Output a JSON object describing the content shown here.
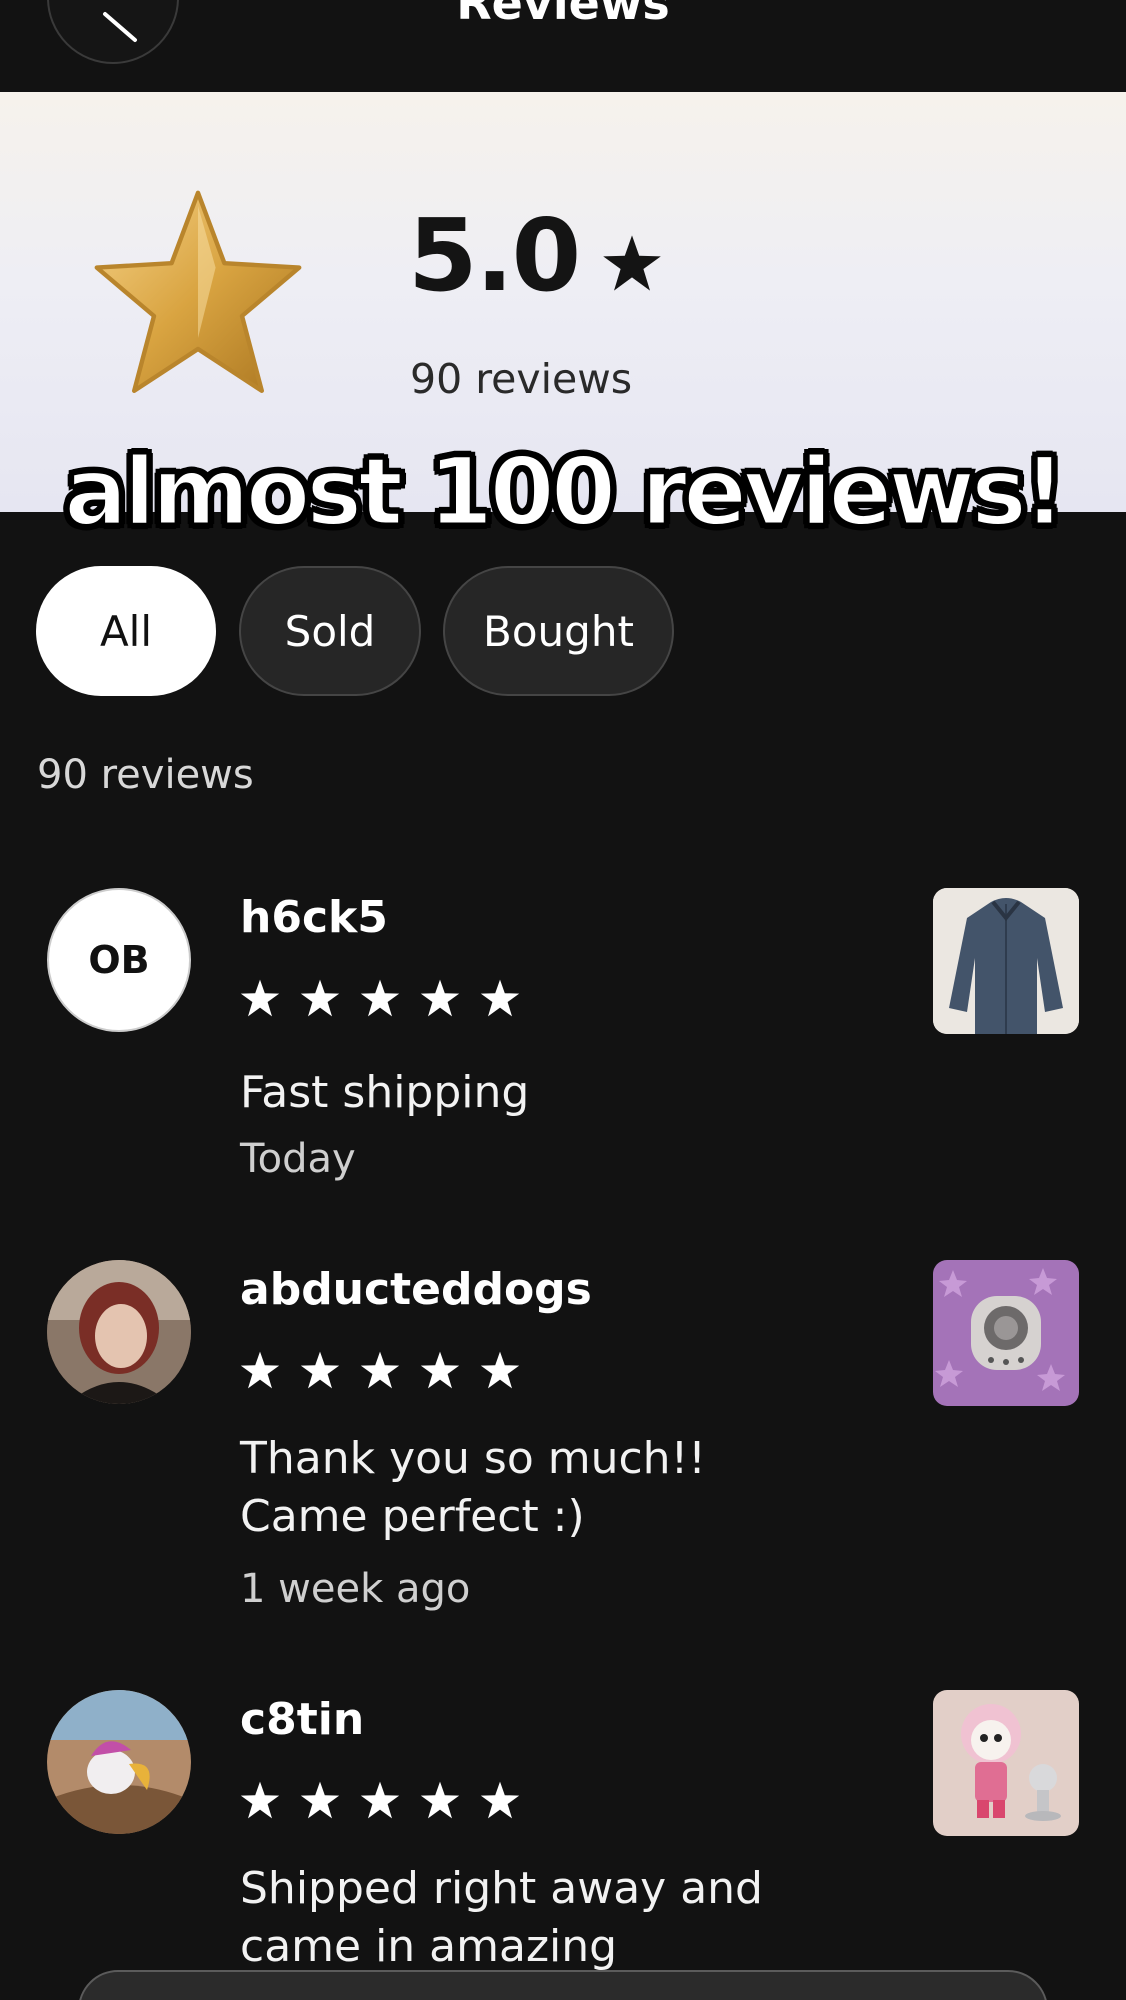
{
  "header": {
    "title": "Reviews",
    "back_icon": "chevron-left-icon"
  },
  "summary": {
    "rating": "5.0",
    "review_count_text": "90 reviews",
    "star_color": "#d9a441"
  },
  "overlay_caption": "almost 100 reviews!",
  "filters": [
    {
      "label": "All",
      "selected": true
    },
    {
      "label": "Sold",
      "selected": false
    },
    {
      "label": "Bought",
      "selected": false
    }
  ],
  "list_count_text": "90 reviews",
  "reviews": [
    {
      "avatar_initials": "OB",
      "username": "h6ck5",
      "stars": 5,
      "text_lines": [
        "Fast shipping"
      ],
      "date": "Today",
      "thumbnail": "denim-shirt-photo"
    },
    {
      "avatar_initials": "",
      "username": "abducteddogs",
      "stars": 5,
      "text_lines": [
        "Thank you so much!!",
        "Came perfect :)"
      ],
      "date": "1 week ago",
      "thumbnail": "purple-star-item-photo"
    },
    {
      "avatar_initials": "",
      "username": "c8tin",
      "stars": 5,
      "text_lines": [
        "Shipped right away and",
        "came in amazing"
      ],
      "date": "",
      "thumbnail": "pink-figure-photo"
    }
  ]
}
